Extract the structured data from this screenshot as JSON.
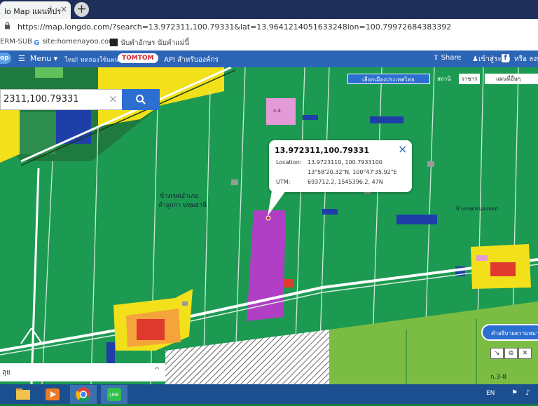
{
  "browser": {
    "tab_title": "lo Map แผนที่ประเทศไ",
    "tab_close": "×",
    "new_tab": "+",
    "url": "https://map.longdo.com/?search=13.972311,100.79331&lat=13.9641214051633248lon=100.79972684383392"
  },
  "bookmarks": [
    {
      "label": "ERM-SUB",
      "icon": "page-icon"
    },
    {
      "label": "site:homenayoo.com",
      "icon": "google-icon"
    },
    {
      "label": "นับคำอักษร นับคำแม่นี้",
      "icon": "dark-app-icon"
    }
  ],
  "app_header": {
    "logo": "op",
    "menu_label": "Menu",
    "promo_text": "ใหม่! ทดลองใช้แผนที่",
    "tomtom_label": "TOMTOM",
    "api_label": "API สำหรับองค์กร",
    "share_label": "Share",
    "login_label": "เข้าสู่ระบบ",
    "or_label": "หรือ ลงท"
  },
  "search": {
    "value": "2311,100.79331",
    "clear_label": "×"
  },
  "map_controls": {
    "province_select": "เลือกเมืองประเทศไทย",
    "station_label": "สถานี",
    "station_select": "ราชาร",
    "layer_select": "แผนที่อื่นๆ"
  },
  "popup": {
    "title": "13.972311,100.79331",
    "close": "×",
    "location_label": "Location:",
    "location_decimal": "13.9723110, 100.7933100",
    "location_dms": "13°58'20.32\"N, 100°47'35.92\"E",
    "utm_label": "UTM:",
    "utm_value": "693712.2, 1545396.2, 47N"
  },
  "map_labels": {
    "thai_label_left": "ข้างเขตอำเภอ",
    "thai_label_left2": "ลำลูกกา ปทุมธานี",
    "thai_label_right": "ข้างเขตหนองจอก",
    "zone_a": "ก.4",
    "zone_b": "ก.3-8"
  },
  "legend": {
    "label": "คำอธิบายความหมาย"
  },
  "bottom_panel": {
    "text": "ลุย",
    "toggle": "^"
  },
  "taskbar": {
    "language": "EN"
  },
  "colors": {
    "map_green": "#1d9a52",
    "field_green": "#22a556",
    "residential_yellow": "#f2e01a",
    "commercial_red": "#e03a2f",
    "industrial_purple": "#b03fc6",
    "blue_zone": "#1e3fa8",
    "header_blue": "#2d65b6",
    "tab_bar": "#1e2f5a",
    "taskbar": "#1b4f8f"
  }
}
